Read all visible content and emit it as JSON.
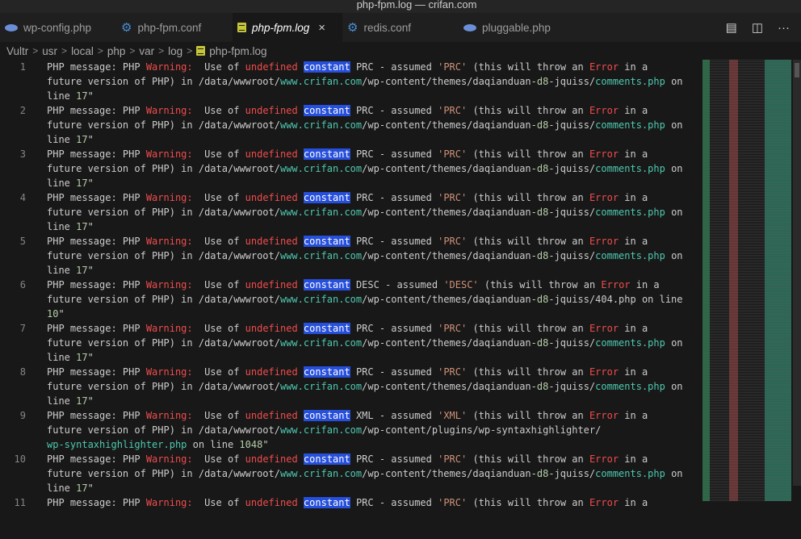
{
  "window": {
    "title": "php-fpm.log — crifan.com"
  },
  "tabs": [
    {
      "label": "wp-config.php",
      "icon": "php-icon"
    },
    {
      "label": "php-fpm.conf",
      "icon": "gear-icon"
    },
    {
      "label": "php-fpm.log",
      "icon": "log-file-icon",
      "active": true,
      "close": "×"
    },
    {
      "label": "redis.conf",
      "icon": "gear-icon"
    },
    {
      "label": "pluggable.php",
      "icon": "php-icon"
    }
  ],
  "actions": {
    "preview": "▤",
    "split": "◫",
    "more": "···"
  },
  "breadcrumb": [
    "Vultr",
    "usr",
    "local",
    "php",
    "var",
    "log",
    "php-fpm.log"
  ],
  "breadcrumb_sep": ">",
  "lines": [
    {
      "n": "1",
      "text": [
        "PHP message: PHP Warning:  Use of undefined constant PRC - assumed 'PRC' (this will throw an Error in a",
        "future version of PHP) in /data/wwwroot/www.crifan.com/wp-content/themes/daqianduan-d8-jquiss/comments.php on",
        "line 17\""
      ]
    },
    {
      "n": "2",
      "text": [
        "PHP message: PHP Warning:  Use of undefined constant PRC - assumed 'PRC' (this will throw an Error in a",
        "future version of PHP) in /data/wwwroot/www.crifan.com/wp-content/themes/daqianduan-d8-jquiss/comments.php on",
        "line 17\""
      ]
    },
    {
      "n": "3",
      "text": [
        "PHP message: PHP Warning:  Use of undefined constant PRC - assumed 'PRC' (this will throw an Error in a",
        "future version of PHP) in /data/wwwroot/www.crifan.com/wp-content/themes/daqianduan-d8-jquiss/comments.php on",
        "line 17\""
      ]
    },
    {
      "n": "4",
      "text": [
        "PHP message: PHP Warning:  Use of undefined constant PRC - assumed 'PRC' (this will throw an Error in a",
        "future version of PHP) in /data/wwwroot/www.crifan.com/wp-content/themes/daqianduan-d8-jquiss/comments.php on",
        "line 17\""
      ]
    },
    {
      "n": "5",
      "text": [
        "PHP message: PHP Warning:  Use of undefined constant PRC - assumed 'PRC' (this will throw an Error in a",
        "future version of PHP) in /data/wwwroot/www.crifan.com/wp-content/themes/daqianduan-d8-jquiss/comments.php on",
        "line 17\""
      ]
    },
    {
      "n": "6",
      "text": [
        "PHP message: PHP Warning:  Use of undefined constant DESC - assumed 'DESC' (this will throw an Error in a",
        "future version of PHP) in /data/wwwroot/www.crifan.com/wp-content/themes/daqianduan-d8-jquiss/404.php on line",
        "10\""
      ]
    },
    {
      "n": "7",
      "text": [
        "PHP message: PHP Warning:  Use of undefined constant PRC - assumed 'PRC' (this will throw an Error in a",
        "future version of PHP) in /data/wwwroot/www.crifan.com/wp-content/themes/daqianduan-d8-jquiss/comments.php on",
        "line 17\""
      ]
    },
    {
      "n": "8",
      "text": [
        "PHP message: PHP Warning:  Use of undefined constant PRC - assumed 'PRC' (this will throw an Error in a",
        "future version of PHP) in /data/wwwroot/www.crifan.com/wp-content/themes/daqianduan-d8-jquiss/comments.php on",
        "line 17\""
      ]
    },
    {
      "n": "9",
      "text": [
        "PHP message: PHP Warning:  Use of undefined constant XML - assumed 'XML' (this will throw an Error in a",
        "future version of PHP) in /data/wwwroot/www.crifan.com/wp-content/plugins/wp-syntaxhighlighter/",
        "wp-syntaxhighlighter.php on line 1048\""
      ]
    },
    {
      "n": "10",
      "text": [
        "PHP message: PHP Warning:  Use of undefined constant PRC - assumed 'PRC' (this will throw an Error in a",
        "future version of PHP) in /data/wwwroot/www.crifan.com/wp-content/themes/daqianduan-d8-jquiss/comments.php on",
        "line 17\""
      ]
    },
    {
      "n": "11",
      "text": [
        "PHP message: PHP Warning:  Use of undefined constant PRC - assumed 'PRC' (this will throw an Error in a"
      ]
    }
  ],
  "colors": {
    "error": "#f14c4c",
    "string": "#ce9178",
    "link": "#4ec9b0",
    "number": "#b5cea8",
    "highlight": "#264fdb"
  }
}
